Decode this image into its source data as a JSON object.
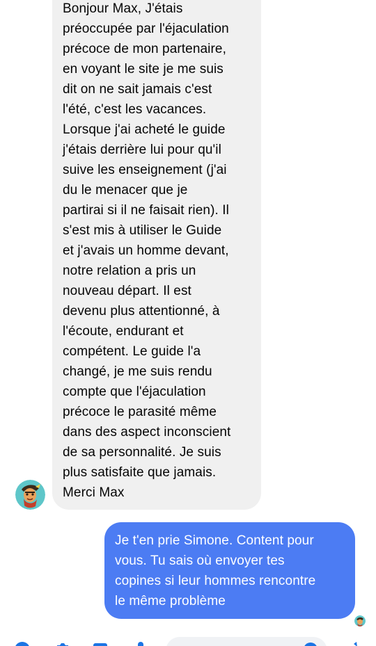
{
  "conversation": {
    "incoming": {
      "text": "Bonjour Max, J'étais\npréoccupée par l'éjaculation\nprécoce de mon partenaire,\nen voyant le site je me suis\ndit on ne sait jamais c'est\nl'été, c'est les vacances.\nLorsque j'ai acheté le guide\nj'étais derrière lui pour qu'il\nsuive les enseignement (j'ai\ndu le menacer que je\npartirai si il ne faisait rien). Il\ns'est mis à utiliser le Guide\net j'avais un homme devant,\nnotre relation a pris un\nnouveau départ. Il est\ndevenu plus attentionné, à\nl'écoute, endurant et\ncompétent. Le guide l'a\nchangé, je me suis rendu\ncompte que l'éjaculation\nprécoce le parasité même\ndans des aspect inconscient\nde sa personnalité. Je suis\nplus satisfaite que jamais.\nMerci Max"
    },
    "outgoing": {
      "text": "Je t'en prie Simone. Content pour\nvous. Tu sais où envoyer tes\ncopines si leur hommes rencontre\nle même problème"
    }
  },
  "colors": {
    "incoming_bubble": "#f0f0f0",
    "outgoing_bubble": "#4c7cf3",
    "accent": "#1b74e4"
  },
  "icons": [
    "contact-avatar",
    "seen-avatar",
    "plus-circle-icon",
    "camera-icon",
    "image-icon",
    "microphone-icon",
    "emoji-icon",
    "like-icon"
  ]
}
